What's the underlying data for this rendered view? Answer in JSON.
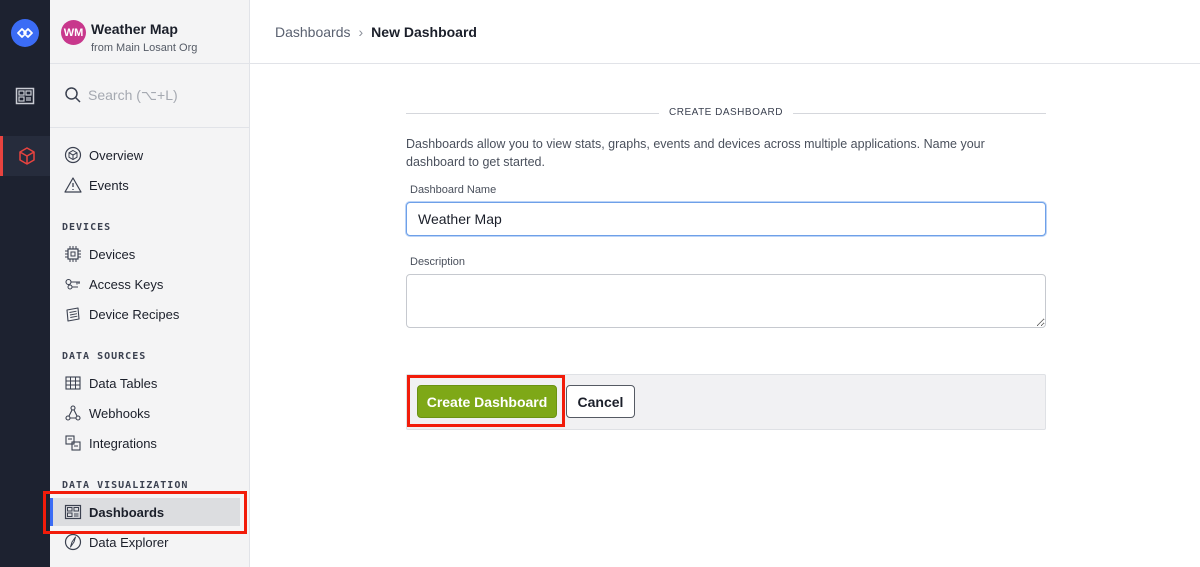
{
  "app": {
    "avatar_initials": "WM",
    "name": "Weather Map",
    "org": "from Main Losant Org"
  },
  "search": {
    "placeholder": "Search (⌥+L)"
  },
  "sidebar": {
    "top_items": [
      {
        "label": "Overview",
        "icon": "cube-outline-icon"
      },
      {
        "label": "Events",
        "icon": "warning-triangle-icon"
      }
    ],
    "sections": [
      {
        "title": "DEVICES",
        "items": [
          {
            "label": "Devices",
            "icon": "chip-icon"
          },
          {
            "label": "Access Keys",
            "icon": "keys-icon"
          },
          {
            "label": "Device Recipes",
            "icon": "recipe-icon"
          }
        ]
      },
      {
        "title": "DATA SOURCES",
        "items": [
          {
            "label": "Data Tables",
            "icon": "table-icon"
          },
          {
            "label": "Webhooks",
            "icon": "webhook-icon"
          },
          {
            "label": "Integrations",
            "icon": "integrations-icon"
          }
        ]
      },
      {
        "title": "DATA VISUALIZATION",
        "items": [
          {
            "label": "Dashboards",
            "icon": "dashboard-icon",
            "active": true
          },
          {
            "label": "Data Explorer",
            "icon": "compass-icon"
          }
        ]
      }
    ]
  },
  "breadcrumb": {
    "parent": "Dashboards",
    "separator": "›",
    "current": "New Dashboard"
  },
  "form": {
    "legend": "CREATE DASHBOARD",
    "intro": "Dashboards allow you to view stats, graphs, events and devices across multiple applications. Name your dashboard to get started.",
    "name_label": "Dashboard Name",
    "name_value": "Weather Map",
    "description_label": "Description",
    "description_value": "",
    "create_label": "Create Dashboard",
    "cancel_label": "Cancel"
  },
  "colors": {
    "rail_bg": "#1d2230",
    "accent_blue": "#3b6cf5",
    "primary_green": "#7ea817",
    "highlight_red": "#f21c0a",
    "avatar_pink": "#c8378c"
  }
}
